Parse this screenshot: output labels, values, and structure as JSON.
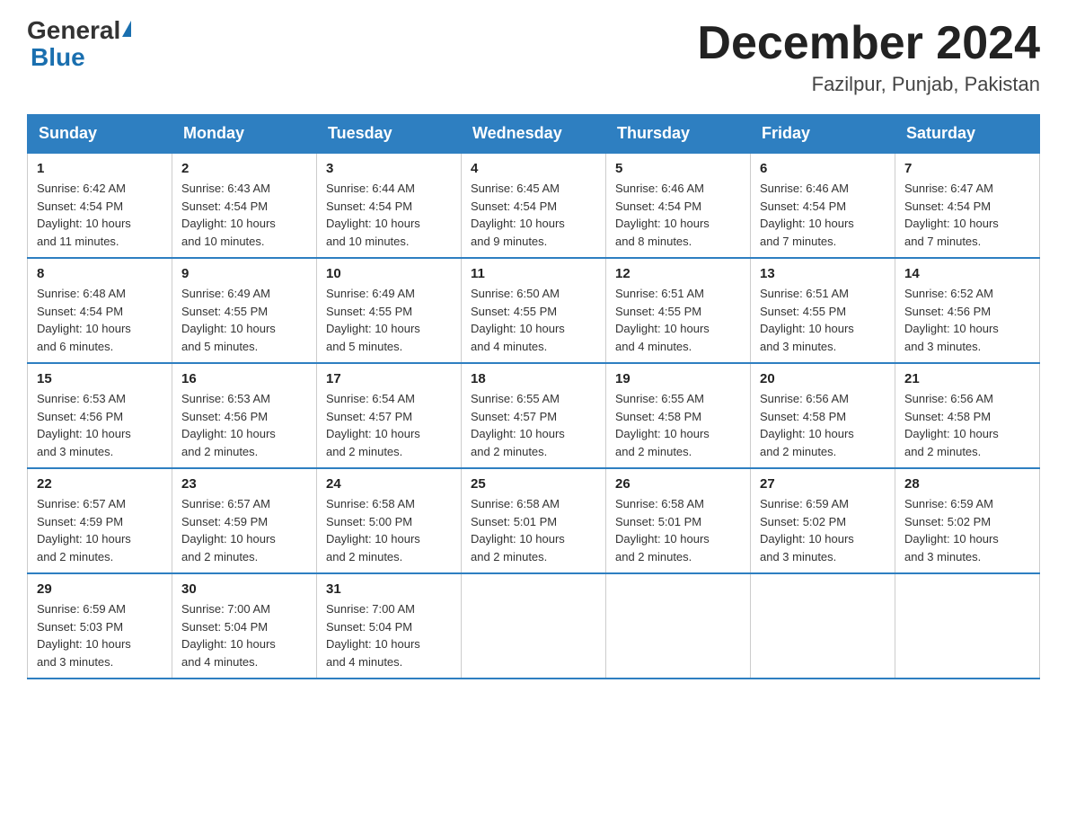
{
  "header": {
    "logo_general": "General",
    "logo_blue": "Blue",
    "month_title": "December 2024",
    "location": "Fazilpur, Punjab, Pakistan"
  },
  "days_of_week": [
    "Sunday",
    "Monday",
    "Tuesday",
    "Wednesday",
    "Thursday",
    "Friday",
    "Saturday"
  ],
  "weeks": [
    [
      {
        "day": "1",
        "sunrise": "6:42 AM",
        "sunset": "4:54 PM",
        "daylight": "10 hours and 11 minutes."
      },
      {
        "day": "2",
        "sunrise": "6:43 AM",
        "sunset": "4:54 PM",
        "daylight": "10 hours and 10 minutes."
      },
      {
        "day": "3",
        "sunrise": "6:44 AM",
        "sunset": "4:54 PM",
        "daylight": "10 hours and 10 minutes."
      },
      {
        "day": "4",
        "sunrise": "6:45 AM",
        "sunset": "4:54 PM",
        "daylight": "10 hours and 9 minutes."
      },
      {
        "day": "5",
        "sunrise": "6:46 AM",
        "sunset": "4:54 PM",
        "daylight": "10 hours and 8 minutes."
      },
      {
        "day": "6",
        "sunrise": "6:46 AM",
        "sunset": "4:54 PM",
        "daylight": "10 hours and 7 minutes."
      },
      {
        "day": "7",
        "sunrise": "6:47 AM",
        "sunset": "4:54 PM",
        "daylight": "10 hours and 7 minutes."
      }
    ],
    [
      {
        "day": "8",
        "sunrise": "6:48 AM",
        "sunset": "4:54 PM",
        "daylight": "10 hours and 6 minutes."
      },
      {
        "day": "9",
        "sunrise": "6:49 AM",
        "sunset": "4:55 PM",
        "daylight": "10 hours and 5 minutes."
      },
      {
        "day": "10",
        "sunrise": "6:49 AM",
        "sunset": "4:55 PM",
        "daylight": "10 hours and 5 minutes."
      },
      {
        "day": "11",
        "sunrise": "6:50 AM",
        "sunset": "4:55 PM",
        "daylight": "10 hours and 4 minutes."
      },
      {
        "day": "12",
        "sunrise": "6:51 AM",
        "sunset": "4:55 PM",
        "daylight": "10 hours and 4 minutes."
      },
      {
        "day": "13",
        "sunrise": "6:51 AM",
        "sunset": "4:55 PM",
        "daylight": "10 hours and 3 minutes."
      },
      {
        "day": "14",
        "sunrise": "6:52 AM",
        "sunset": "4:56 PM",
        "daylight": "10 hours and 3 minutes."
      }
    ],
    [
      {
        "day": "15",
        "sunrise": "6:53 AM",
        "sunset": "4:56 PM",
        "daylight": "10 hours and 3 minutes."
      },
      {
        "day": "16",
        "sunrise": "6:53 AM",
        "sunset": "4:56 PM",
        "daylight": "10 hours and 2 minutes."
      },
      {
        "day": "17",
        "sunrise": "6:54 AM",
        "sunset": "4:57 PM",
        "daylight": "10 hours and 2 minutes."
      },
      {
        "day": "18",
        "sunrise": "6:55 AM",
        "sunset": "4:57 PM",
        "daylight": "10 hours and 2 minutes."
      },
      {
        "day": "19",
        "sunrise": "6:55 AM",
        "sunset": "4:58 PM",
        "daylight": "10 hours and 2 minutes."
      },
      {
        "day": "20",
        "sunrise": "6:56 AM",
        "sunset": "4:58 PM",
        "daylight": "10 hours and 2 minutes."
      },
      {
        "day": "21",
        "sunrise": "6:56 AM",
        "sunset": "4:58 PM",
        "daylight": "10 hours and 2 minutes."
      }
    ],
    [
      {
        "day": "22",
        "sunrise": "6:57 AM",
        "sunset": "4:59 PM",
        "daylight": "10 hours and 2 minutes."
      },
      {
        "day": "23",
        "sunrise": "6:57 AM",
        "sunset": "4:59 PM",
        "daylight": "10 hours and 2 minutes."
      },
      {
        "day": "24",
        "sunrise": "6:58 AM",
        "sunset": "5:00 PM",
        "daylight": "10 hours and 2 minutes."
      },
      {
        "day": "25",
        "sunrise": "6:58 AM",
        "sunset": "5:01 PM",
        "daylight": "10 hours and 2 minutes."
      },
      {
        "day": "26",
        "sunrise": "6:58 AM",
        "sunset": "5:01 PM",
        "daylight": "10 hours and 2 minutes."
      },
      {
        "day": "27",
        "sunrise": "6:59 AM",
        "sunset": "5:02 PM",
        "daylight": "10 hours and 3 minutes."
      },
      {
        "day": "28",
        "sunrise": "6:59 AM",
        "sunset": "5:02 PM",
        "daylight": "10 hours and 3 minutes."
      }
    ],
    [
      {
        "day": "29",
        "sunrise": "6:59 AM",
        "sunset": "5:03 PM",
        "daylight": "10 hours and 3 minutes."
      },
      {
        "day": "30",
        "sunrise": "7:00 AM",
        "sunset": "5:04 PM",
        "daylight": "10 hours and 4 minutes."
      },
      {
        "day": "31",
        "sunrise": "7:00 AM",
        "sunset": "5:04 PM",
        "daylight": "10 hours and 4 minutes."
      },
      null,
      null,
      null,
      null
    ]
  ],
  "labels": {
    "sunrise": "Sunrise:",
    "sunset": "Sunset:",
    "daylight": "Daylight:"
  }
}
